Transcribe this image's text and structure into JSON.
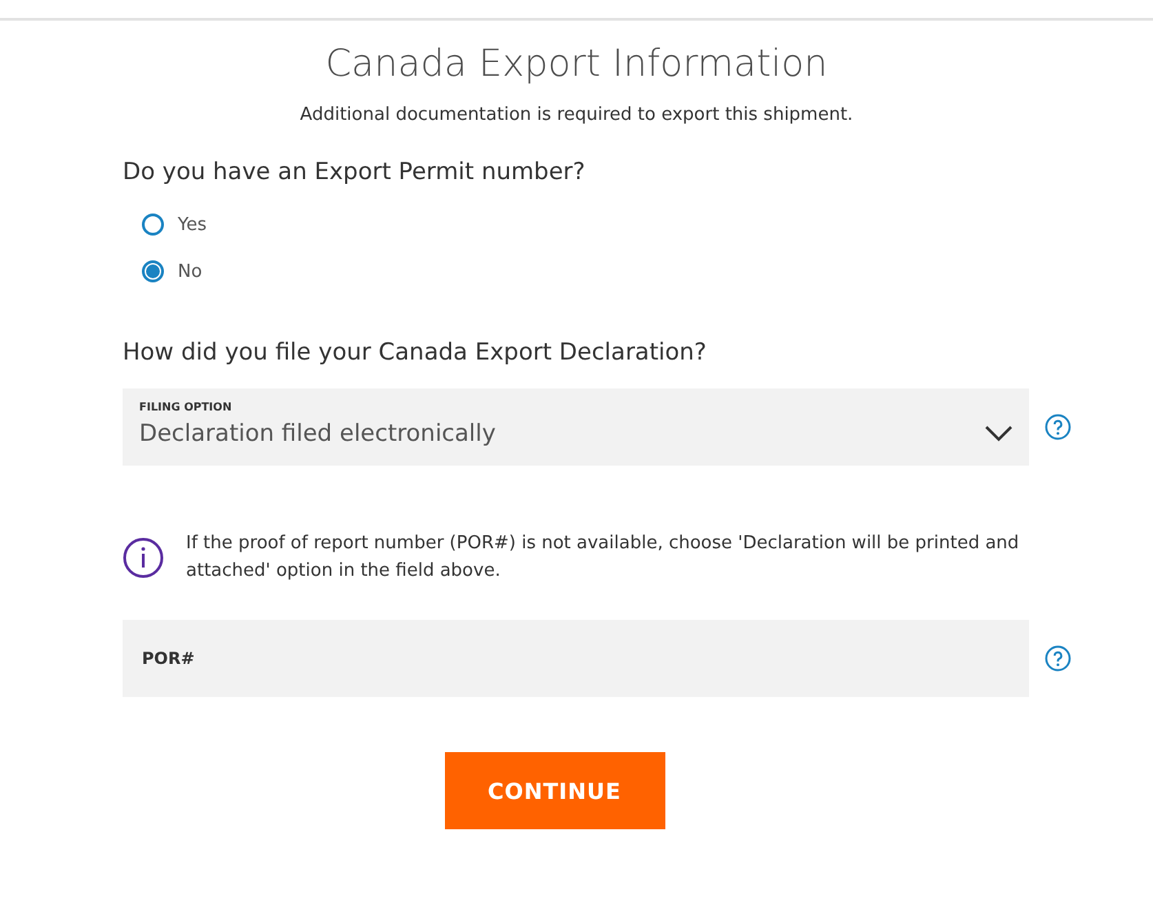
{
  "title": "Canada Export Information",
  "subtitle": "Additional documentation is required to export this shipment.",
  "permit_question": "Do you have an Export Permit number?",
  "permit_options": [
    {
      "label": "Yes",
      "selected": false
    },
    {
      "label": "No",
      "selected": true
    }
  ],
  "filing_question": "How did you file your Canada Export Declaration?",
  "filing_select": {
    "label": "FILING OPTION",
    "value": "Declaration filed electronically"
  },
  "info_note": "If the proof of report number (POR#) is not available, choose 'Declaration will be printed and attached' option in the field above.",
  "por_field": {
    "placeholder": "POR#"
  },
  "continue_button": "CONTINUE"
}
